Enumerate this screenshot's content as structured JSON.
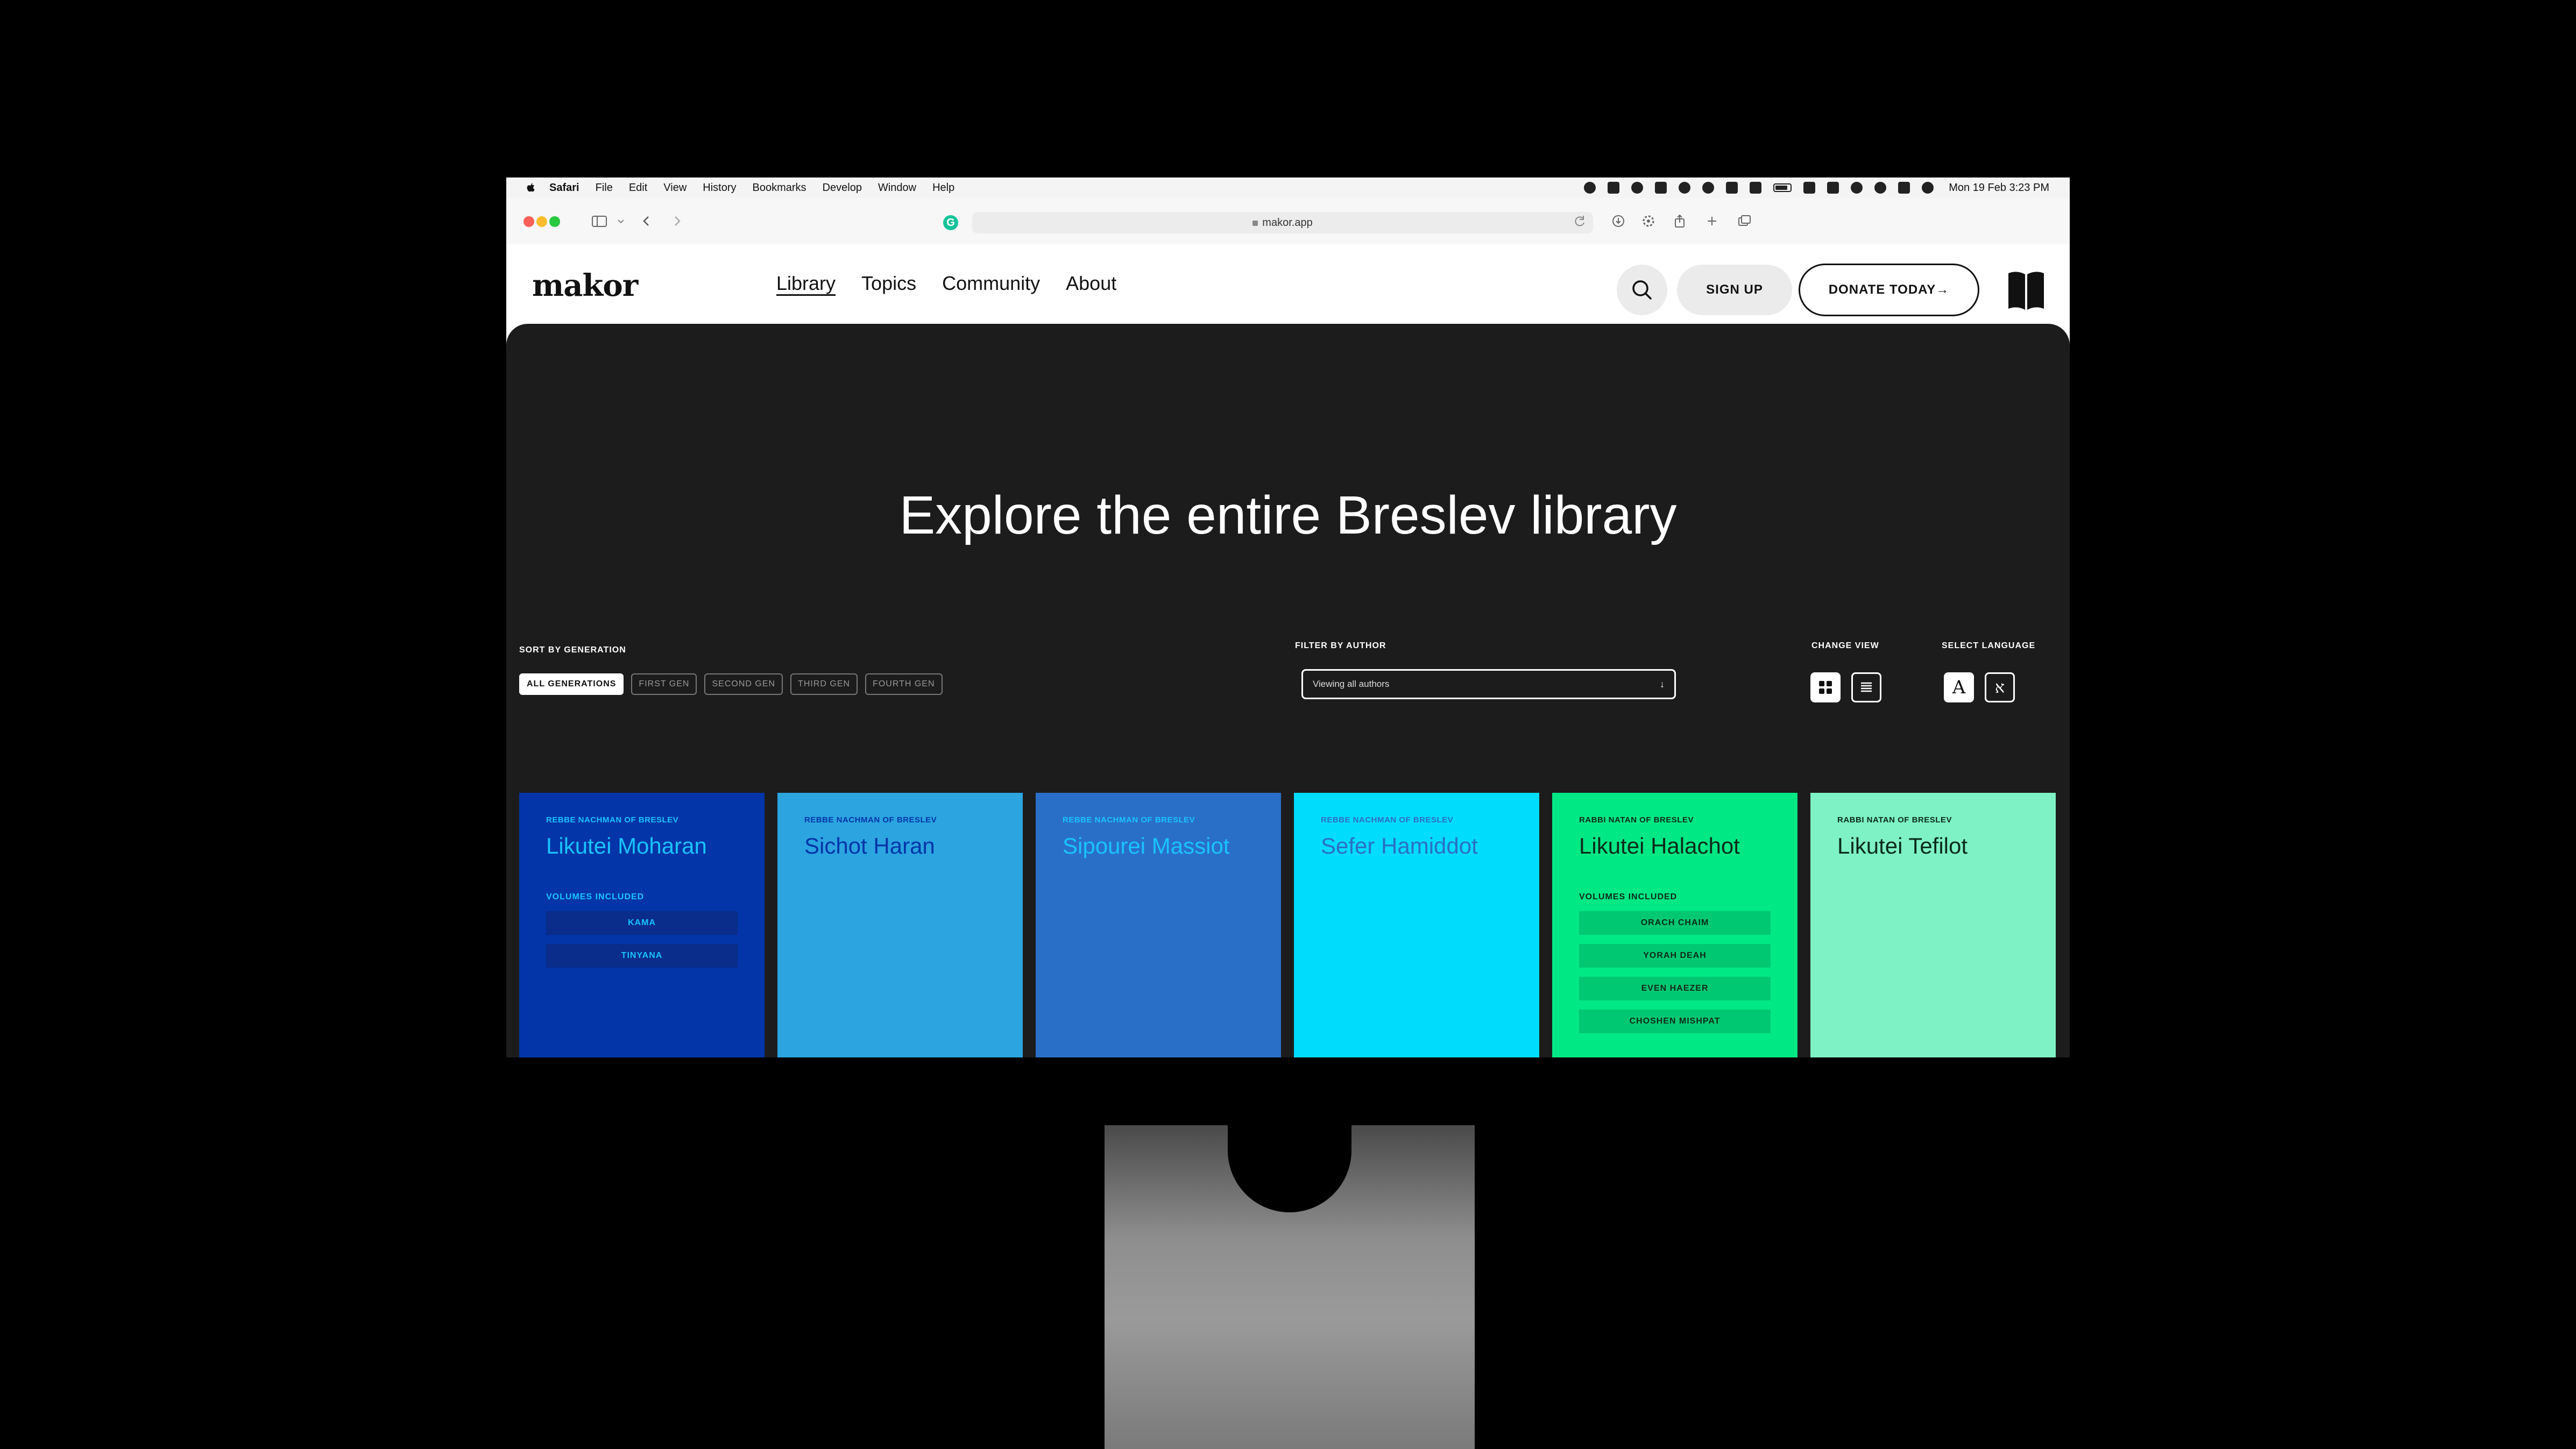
{
  "menubar": {
    "app": "Safari",
    "items": [
      "File",
      "Edit",
      "View",
      "History",
      "Bookmarks",
      "Develop",
      "Window",
      "Help"
    ],
    "clock": "Mon 19 Feb  3:23 PM"
  },
  "browser": {
    "url": "makor.app"
  },
  "header": {
    "logo": "makor",
    "nav": [
      {
        "label": "Library",
        "active": true
      },
      {
        "label": "Topics"
      },
      {
        "label": "Community"
      },
      {
        "label": "About"
      }
    ],
    "signup": "SIGN UP",
    "donate": "DONATE TODAY→"
  },
  "hero": {
    "title": "Explore the entire Breslev library"
  },
  "controls": {
    "sort_label": "SORT BY GENERATION",
    "generations": [
      "ALL GENERATIONS",
      "FIRST GEN",
      "SECOND GEN",
      "THIRD GEN",
      "FOURTH GEN"
    ],
    "filter_label": "FILTER BY AUTHOR",
    "filter_value": "Viewing all authors",
    "view_label": "CHANGE VIEW",
    "language_label": "SELECT LANGUAGE",
    "lang_en": "A",
    "lang_he": "א"
  },
  "books": [
    {
      "author": "REBBE NACHMAN OF BRESLEV",
      "title": "Likutei Moharan",
      "bg": "#0335a8",
      "fg": "#19c3ff",
      "vol_label": "VOLUMES INCLUDED",
      "vol_bg": "#0a2c8a",
      "volumes": [
        "KAMA",
        "TINYANA"
      ]
    },
    {
      "author": "REBBE NACHMAN OF BRESLEV",
      "title": "Sichot Haran",
      "bg": "#2ba4e0",
      "fg": "#0535a8"
    },
    {
      "author": "REBBE NACHMAN OF BRESLEV",
      "title": "Sipourei Massiot",
      "bg": "#2a6fc7",
      "fg": "#19c3ff"
    },
    {
      "author": "REBBE NACHMAN OF BRESLEV",
      "title": "Sefer Hamiddot",
      "bg": "#00dcfb",
      "fg": "#2a6fc7"
    },
    {
      "author": "RABBI NATAN OF BRESLEV",
      "title": "Likutei Halachot",
      "bg": "#00e884",
      "fg": "#0b2a1a",
      "vol_label": "VOLUMES INCLUDED",
      "vol_bg": "#00c872",
      "volumes": [
        "ORACH CHAIM",
        "YORAH DEAH",
        "EVEN HAEZER",
        "CHOSHEN MISHPAT"
      ]
    },
    {
      "author": "RABBI NATAN OF BRESLEV",
      "title": "Likutei Tefilot",
      "bg": "#7ef2c4",
      "fg": "#0b2a1a"
    }
  ]
}
